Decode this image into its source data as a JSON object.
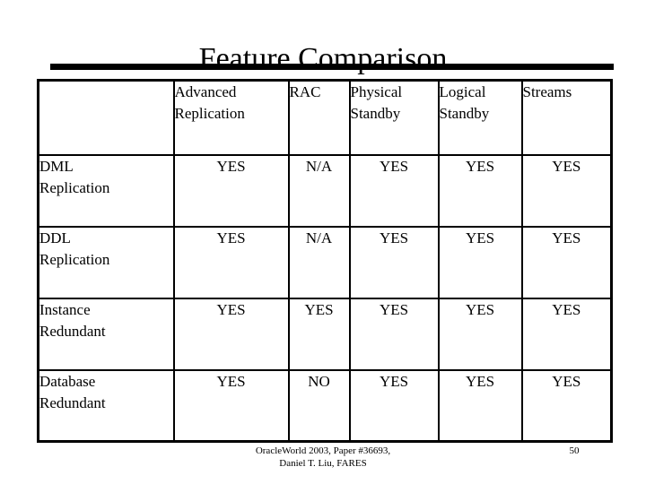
{
  "slide": {
    "title": "Feature Comparison",
    "page_number": "50",
    "footer": {
      "line1": "OracleWorld 2003, Paper #36693,",
      "line2": "Daniel T. Liu, FARES"
    },
    "colors": {
      "text": "#000000",
      "background": "#ffffff",
      "rule": "#000000",
      "border": "#000000"
    }
  },
  "table": {
    "headers": [
      {
        "line1": "",
        "line2": ""
      },
      {
        "line1": "Advanced",
        "line2": "Replication"
      },
      {
        "line1": "RAC",
        "line2": ""
      },
      {
        "line1": "Physical",
        "line2": "Standby"
      },
      {
        "line1": "Logical",
        "line2": "Standby"
      },
      {
        "line1": "Streams",
        "line2": ""
      }
    ],
    "rows": [
      {
        "label_line1": "DML",
        "label_line2": "Replication",
        "values": [
          "YES",
          "N/A",
          "YES",
          "YES",
          "YES"
        ]
      },
      {
        "label_line1": "DDL",
        "label_line2": "Replication",
        "values": [
          "YES",
          "N/A",
          "YES",
          "YES",
          "YES"
        ]
      },
      {
        "label_line1": "Instance",
        "label_line2": "Redundant",
        "values": [
          "YES",
          "YES",
          "YES",
          "YES",
          "YES"
        ]
      },
      {
        "label_line1": "Database",
        "label_line2": "Redundant",
        "values": [
          "YES",
          "NO",
          "YES",
          "YES",
          "YES"
        ]
      }
    ]
  }
}
